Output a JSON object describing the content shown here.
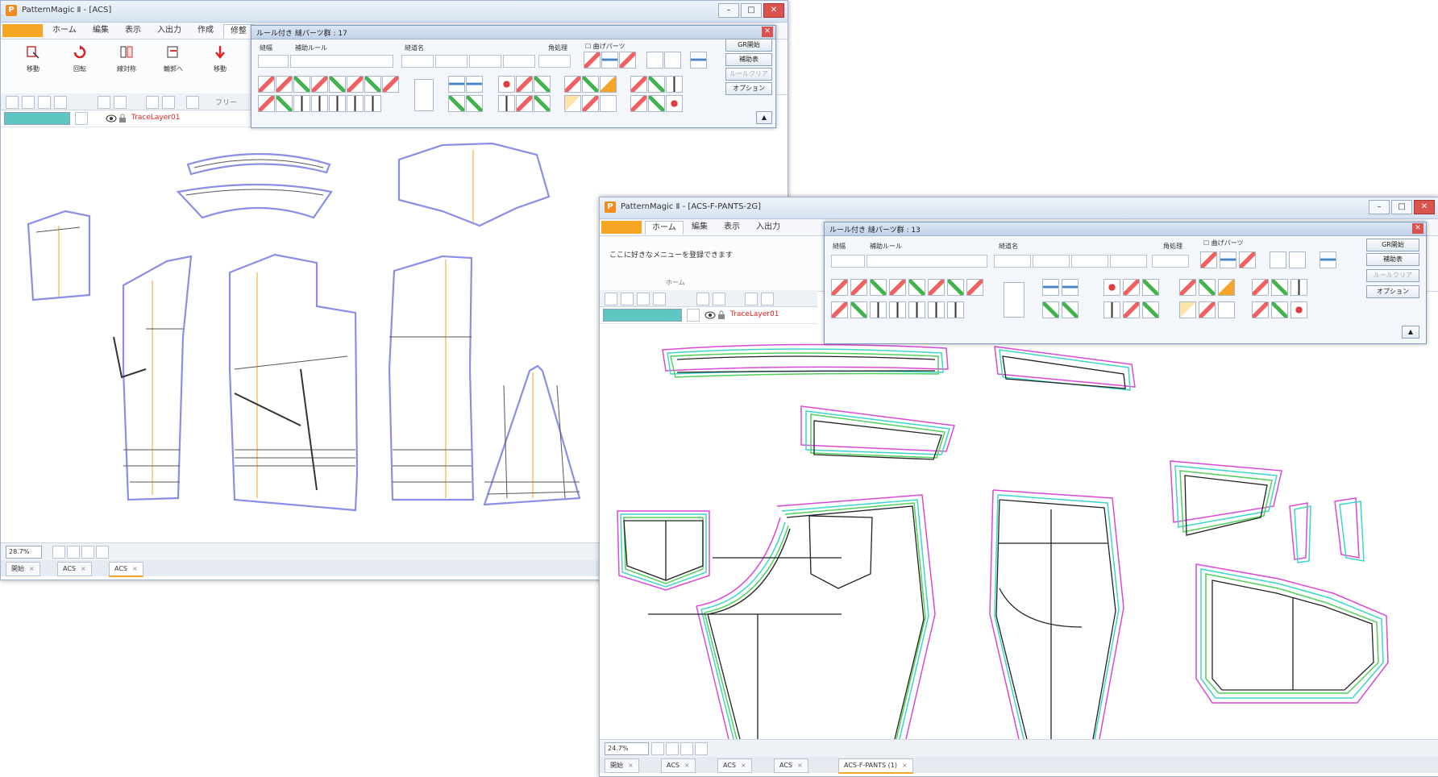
{
  "window1": {
    "title": "PatternMagic Ⅱ - [ACS]",
    "ribbon_tabs": [
      "ホーム",
      "編集",
      "表示",
      "入出力",
      "作成",
      "修整"
    ],
    "ribbon_buttons": [
      "移動",
      "回転",
      "線対称",
      "輪郭へ",
      "移動"
    ],
    "toolbar_label": "フリー",
    "layer_name": "TraceLayer01",
    "zoom": "28.7%",
    "doc_tabs": [
      "開始",
      "ACS",
      "ACS"
    ]
  },
  "window2": {
    "title": "PatternMagic Ⅱ - [ACS-F-PANTS-2G]",
    "ribbon_tabs": [
      "ホーム",
      "編集",
      "表示",
      "入出力"
    ],
    "home_hint": "ここに好きなメニューを登録できます",
    "group_label": "ホーム",
    "layer_name": "TraceLayer01",
    "zoom": "24.7%",
    "doc_tabs": [
      "開始",
      "ACS",
      "ACS",
      "ACS",
      "ACS-F-PANTS (1)"
    ]
  },
  "palette1": {
    "title": "ルール付き 縫パーツ群 : 17",
    "labels": [
      "縫幅",
      "補助ルール",
      "縫道名",
      "角処理"
    ],
    "checkbox": "曲げパーツ",
    "buttons": [
      "GR開始",
      "補助表",
      "ルールクリア",
      "オプション"
    ]
  },
  "palette2": {
    "title": "ルール付き 縫パーツ群 : 13",
    "labels": [
      "縫幅",
      "補助ルール",
      "縫道名",
      "角処理"
    ],
    "checkbox": "曲げパーツ",
    "buttons": [
      "GR開始",
      "補助表",
      "ルールクリア",
      "オプション"
    ]
  },
  "colors": {
    "app_orange": "#f5a623",
    "outline_purple": "#7b7fe0",
    "grain_orange": "#f5b04a",
    "grade_magenta": "#d94ad9",
    "grade_cyan": "#3dd6c8",
    "grade_green": "#52d05a",
    "layer_red": "#e02020"
  },
  "icons": [
    "app-icon",
    "minimize-icon",
    "maximize-icon",
    "close-icon",
    "eye-icon",
    "lock-icon"
  ]
}
